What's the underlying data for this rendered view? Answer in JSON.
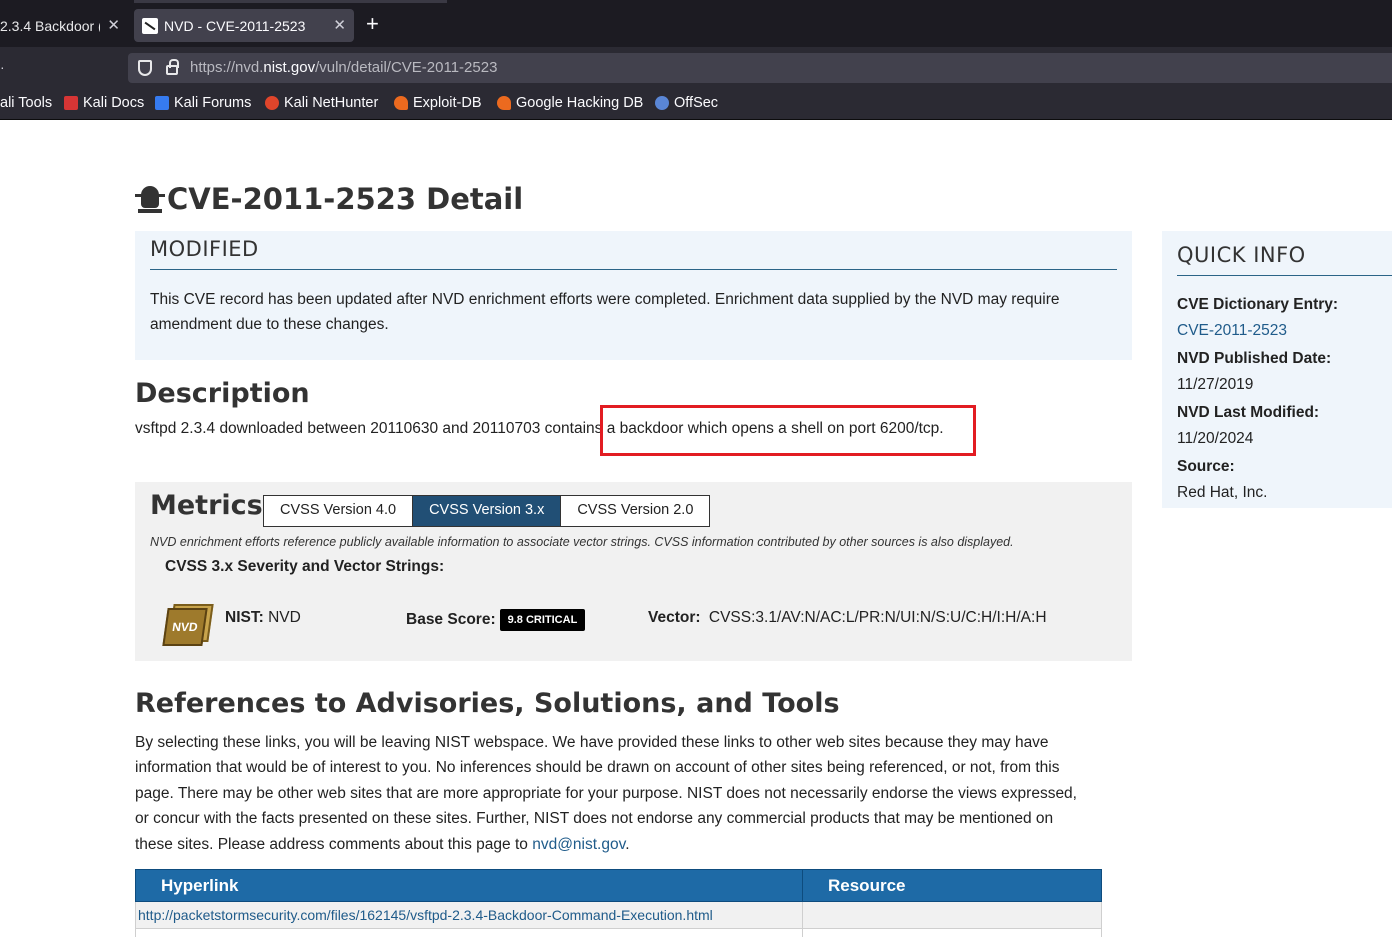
{
  "browser": {
    "tabs": [
      {
        "title": "2.3.4 Backdoor (",
        "active": false
      },
      {
        "title": "NVD - CVE-2011-2523",
        "active": true
      }
    ],
    "new_tab_symbol": "+",
    "close_symbol": "✕",
    "url_scheme": "https://nvd.",
    "url_host": "nist.gov",
    "url_path": "/vuln/detail/CVE-2011-2523",
    "bookmarks": [
      {
        "label": "ali Tools",
        "icon": "kali-tools-icon"
      },
      {
        "label": "Kali Docs",
        "icon": "kali-docs-icon",
        "color": "#d63535"
      },
      {
        "label": "Kali Forums",
        "icon": "kali-forums-icon",
        "color": "#367bf0"
      },
      {
        "label": "Kali NetHunter",
        "icon": "kali-nethunter-icon",
        "color": "#e0452b"
      },
      {
        "label": "Exploit-DB",
        "icon": "exploit-db-icon",
        "color": "#ec6a1f"
      },
      {
        "label": "Google Hacking DB",
        "icon": "ghdb-icon",
        "color": "#ec6a1f"
      },
      {
        "label": "OffSec",
        "icon": "offsec-icon",
        "color": "#5a86d6"
      }
    ]
  },
  "page": {
    "title": "CVE-2011-2523 Detail",
    "modified": {
      "heading": "MODIFIED",
      "text": "This CVE record has been updated after NVD enrichment efforts were completed. Enrichment data supplied by the NVD may require amendment due to these changes."
    },
    "description": {
      "heading": "Description",
      "text": "vsftpd 2.3.4 downloaded between 20110630 and 20110703 contains a backdoor which opens a shell on port 6200/tcp."
    },
    "metrics": {
      "heading": "Metrics",
      "tabs": [
        "CVSS Version 4.0",
        "CVSS Version 3.x",
        "CVSS Version 2.0"
      ],
      "active_tab": "CVSS Version 3.x",
      "note": "NVD enrichment efforts reference publicly available information to associate vector strings. CVSS information contributed by other sources is also displayed.",
      "severity_heading": "CVSS 3.x Severity and Vector Strings:",
      "badge_text": "NVD",
      "source_label": "NIST:",
      "source_value": "NVD",
      "base_score_label": "Base Score:",
      "base_score_value": "9.8 CRITICAL",
      "vector_label": "Vector:",
      "vector_value": "CVSS:3.1/AV:N/AC:L/PR:N/UI:N/S:U/C:H/I:H/A:H"
    },
    "references": {
      "heading": "References to Advisories, Solutions, and Tools",
      "text_before": "By selecting these links, you will be leaving NIST webspace. We have provided these links to other web sites because they may have information that would be of interest to you. No inferences should be drawn on account of other sites being referenced, or not, from this page. There may be other web sites that are more appropriate for your purpose. NIST does not necessarily endorse the views expressed, or concur with the facts presented on these sites. Further, NIST does not endorse any commercial products that may be mentioned on these sites. Please address comments about this page to ",
      "email": "nvd@nist.gov",
      "text_after": ".",
      "columns": [
        "Hyperlink",
        "Resource"
      ],
      "rows": [
        {
          "hyperlink": "http://packetstormsecurity.com/files/162145/vsftpd-2.3.4-Backdoor-Command-Execution.html",
          "resource": ""
        }
      ]
    },
    "quick_info": {
      "heading": "QUICK INFO",
      "items": [
        {
          "label": "CVE Dictionary Entry:",
          "value": "CVE-2011-2523"
        },
        {
          "label": "NVD Published Date:",
          "value": "11/27/2019"
        },
        {
          "label": "NVD Last Modified:",
          "value": "11/20/2024"
        },
        {
          "label": "Source:",
          "value": "Red Hat, Inc."
        }
      ]
    }
  }
}
